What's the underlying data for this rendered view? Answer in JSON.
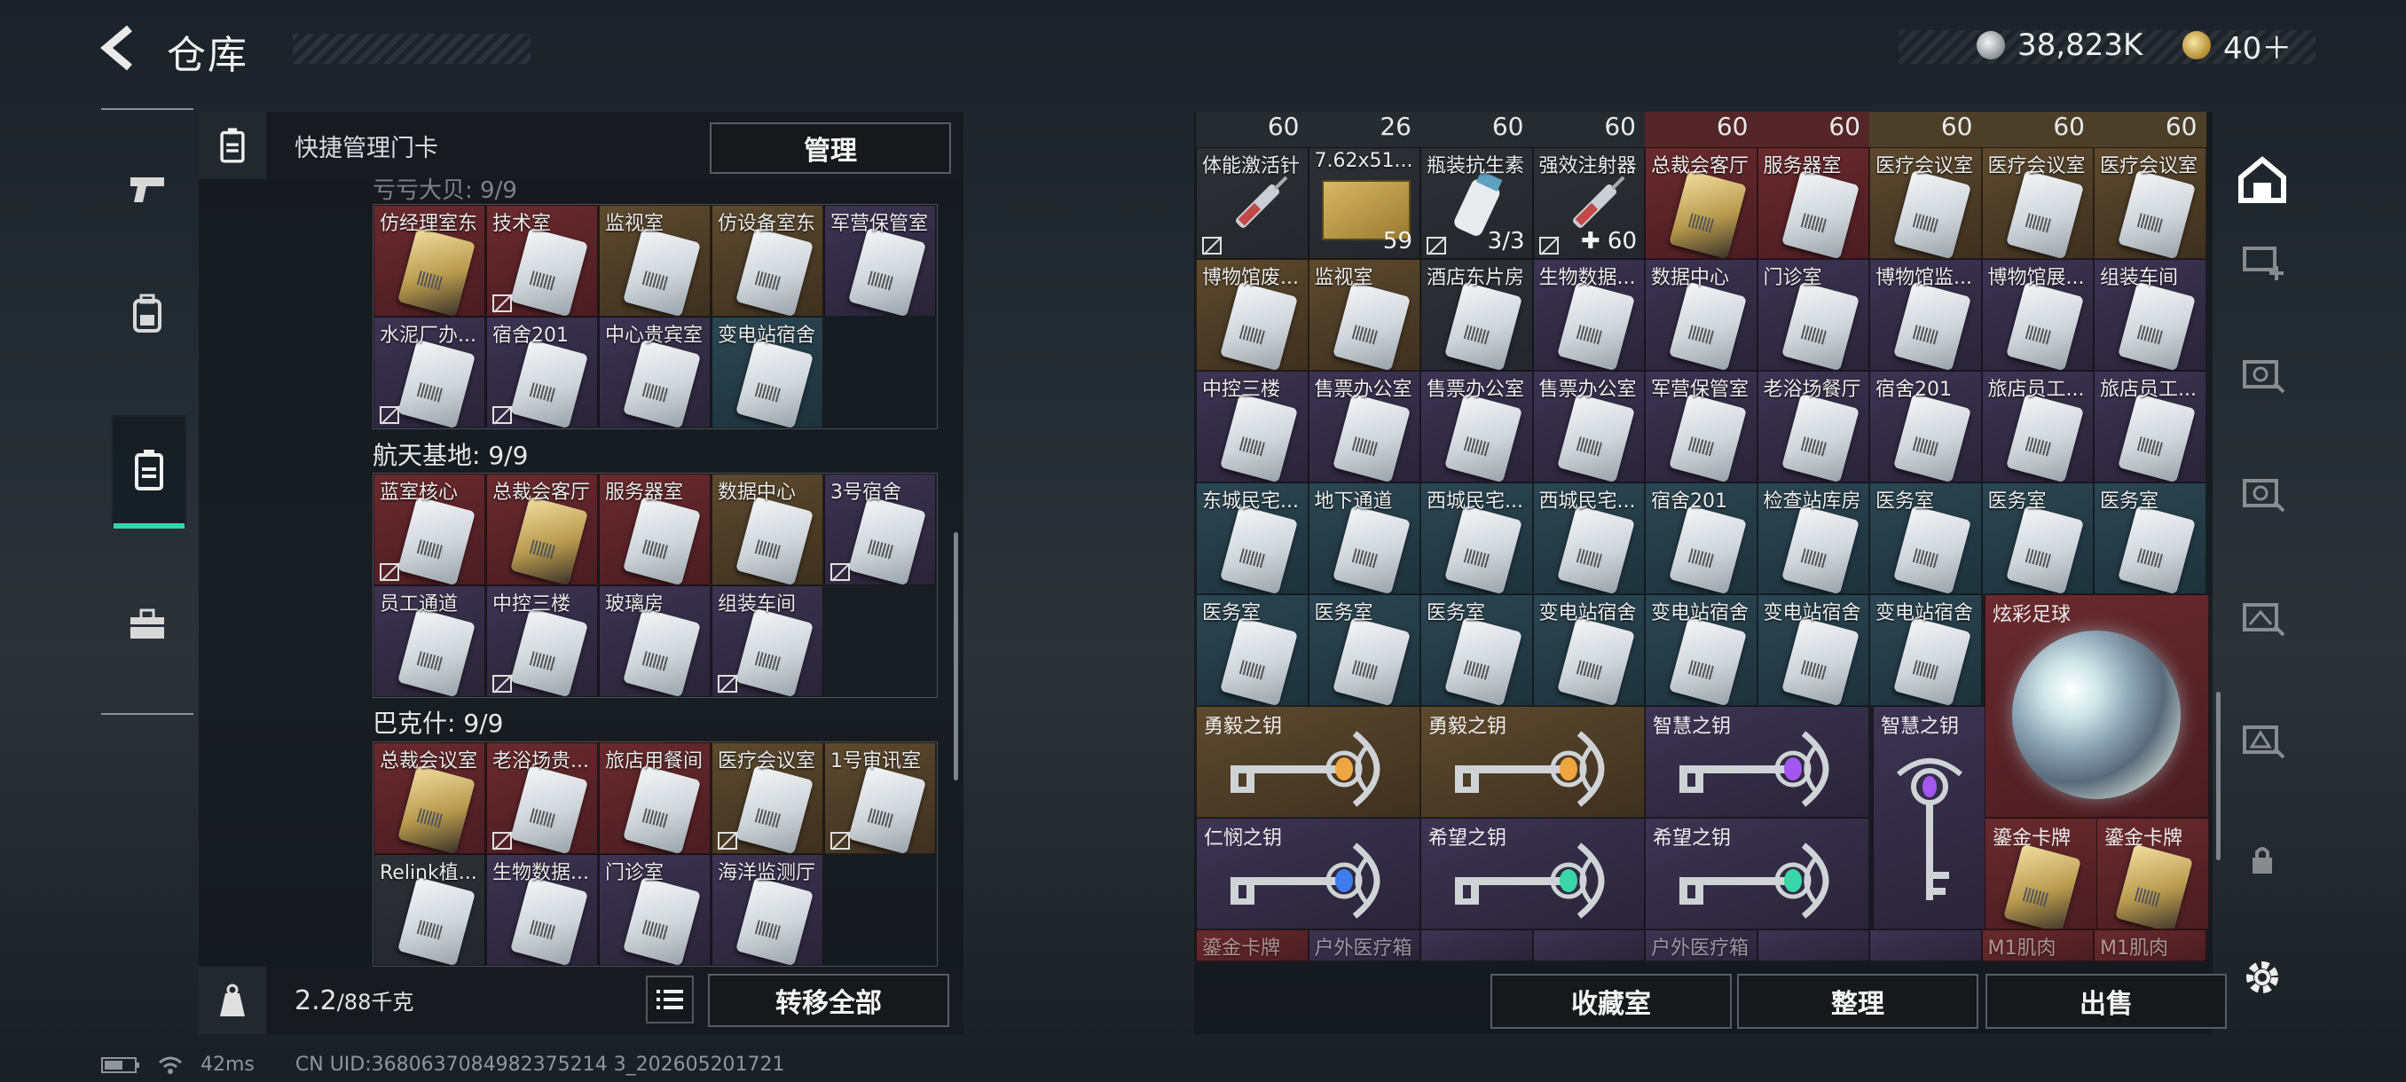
{
  "header": {
    "title": "仓库",
    "currency_silver": "38,823K",
    "currency_gold": "40＋"
  },
  "left_panel": {
    "header_label": "快捷管理门卡",
    "manage_button": "管理",
    "partial_section": "亏亏大贝: 9/9",
    "section1_cards": [
      {
        "name": "仿经理室东",
        "rarity": "r-red",
        "card": "gold",
        "nobind": false
      },
      {
        "name": "技术室",
        "rarity": "r-red",
        "card": "white",
        "nobind": true
      },
      {
        "name": "监视室",
        "rarity": "r-gold",
        "card": "white",
        "nobind": false
      },
      {
        "name": "仿设备室东",
        "rarity": "r-gold",
        "card": "white",
        "nobind": false
      },
      {
        "name": "军营保管室",
        "rarity": "r-purple",
        "card": "white",
        "nobind": false
      },
      {
        "name": "水泥厂办...",
        "rarity": "r-purple",
        "card": "white",
        "nobind": true
      },
      {
        "name": "宿舍201",
        "rarity": "r-purple",
        "card": "white",
        "nobind": true
      },
      {
        "name": "中心贵宾室",
        "rarity": "r-purple",
        "card": "white",
        "nobind": false
      },
      {
        "name": "变电站宿舍",
        "rarity": "r-blue",
        "card": "white",
        "nobind": false
      }
    ],
    "section2_title": "航天基地: 9/9",
    "section2_cards": [
      {
        "name": "蓝室核心",
        "rarity": "r-red",
        "card": "white",
        "nobind": true
      },
      {
        "name": "总裁会客厅",
        "rarity": "r-red",
        "card": "gold",
        "nobind": false
      },
      {
        "name": "服务器室",
        "rarity": "r-red",
        "card": "white",
        "nobind": false
      },
      {
        "name": "数据中心",
        "rarity": "r-gold",
        "card": "white",
        "nobind": false
      },
      {
        "name": "3号宿舍",
        "rarity": "r-purple",
        "card": "white",
        "nobind": true
      },
      {
        "name": "员工通道",
        "rarity": "r-purple",
        "card": "white",
        "nobind": false
      },
      {
        "name": "中控三楼",
        "rarity": "r-purple",
        "card": "white",
        "nobind": true
      },
      {
        "name": "玻璃房",
        "rarity": "r-purple",
        "card": "white",
        "nobind": false
      },
      {
        "name": "组装车间",
        "rarity": "r-purple",
        "card": "white",
        "nobind": true
      }
    ],
    "section3_title": "巴克什: 9/9",
    "section3_cards": [
      {
        "name": "总裁会议室",
        "rarity": "r-red",
        "card": "gold",
        "nobind": false
      },
      {
        "name": "老浴场贵...",
        "rarity": "r-red",
        "card": "white",
        "nobind": true
      },
      {
        "name": "旅店用餐间",
        "rarity": "r-red",
        "card": "white",
        "nobind": false
      },
      {
        "name": "医疗会议室",
        "rarity": "r-gold",
        "card": "white",
        "nobind": true
      },
      {
        "name": "1号审讯室",
        "rarity": "r-gold",
        "card": "white",
        "nobind": true
      },
      {
        "name": "Relink植...",
        "rarity": "r-dark",
        "card": "white",
        "nobind": false
      },
      {
        "name": "生物数据...",
        "rarity": "r-purple",
        "card": "white",
        "nobind": false
      },
      {
        "name": "门诊室",
        "rarity": "r-purple",
        "card": "white",
        "nobind": false
      },
      {
        "name": "海洋监测厅",
        "rarity": "r-purple",
        "card": "white",
        "nobind": false
      }
    ],
    "weight_value": "2.2",
    "weight_max": "/88千克",
    "transfer_button": "转移全部"
  },
  "right_panel": {
    "top_counts": [
      "60",
      "26",
      "60",
      "60",
      "60",
      "60",
      "60",
      "60",
      "60"
    ],
    "rows": [
      [
        {
          "name": "体能激活针",
          "rarity": "r-dark",
          "type": "syringe",
          "count": "",
          "nobind": true
        },
        {
          "name": "7.62x51...",
          "rarity": "r-dark",
          "type": "ammo",
          "count": "59",
          "nobind": false
        },
        {
          "name": "瓶装抗生素",
          "rarity": "r-dark",
          "type": "bottle",
          "count": "3/3",
          "nobind": true
        },
        {
          "name": "强效注射器",
          "rarity": "r-dark",
          "type": "syringe",
          "count": "✚ 60",
          "nobind": true
        },
        {
          "name": "总裁会客厅",
          "rarity": "r-red",
          "type": "card-gold",
          "count": "",
          "nobind": false
        },
        {
          "name": "服务器室",
          "rarity": "r-red",
          "type": "card",
          "count": "",
          "nobind": false
        },
        {
          "name": "医疗会议室",
          "rarity": "r-gold",
          "type": "card",
          "count": "",
          "nobind": false
        },
        {
          "name": "医疗会议室",
          "rarity": "r-gold",
          "type": "card",
          "count": "",
          "nobind": false
        },
        {
          "name": "医疗会议室",
          "rarity": "r-gold",
          "type": "card",
          "count": "",
          "nobind": false
        }
      ],
      [
        {
          "name": "博物馆废...",
          "rarity": "r-gold",
          "type": "card",
          "count": "",
          "nobind": false
        },
        {
          "name": "监视室",
          "rarity": "r-gold",
          "type": "card",
          "count": "",
          "nobind": false
        },
        {
          "name": "酒店东片房",
          "rarity": "r-dark",
          "type": "card",
          "count": "",
          "nobind": false
        },
        {
          "name": "生物数据...",
          "rarity": "r-purple",
          "type": "card",
          "count": "",
          "nobind": false
        },
        {
          "name": "数据中心",
          "rarity": "r-purple",
          "type": "card",
          "count": "",
          "nobind": false
        },
        {
          "name": "门诊室",
          "rarity": "r-purple",
          "type": "card",
          "count": "",
          "nobind": false
        },
        {
          "name": "博物馆监...",
          "rarity": "r-purple",
          "type": "card",
          "count": "",
          "nobind": false
        },
        {
          "name": "博物馆展...",
          "rarity": "r-purple",
          "type": "card",
          "count": "",
          "nobind": false
        },
        {
          "name": "组装车间",
          "rarity": "r-purple",
          "type": "card",
          "count": "",
          "nobind": false
        }
      ],
      [
        {
          "name": "中控三楼",
          "rarity": "r-purple",
          "type": "card",
          "count": "",
          "nobind": false
        },
        {
          "name": "售票办公室",
          "rarity": "r-purple",
          "type": "card",
          "count": "",
          "nobind": false
        },
        {
          "name": "售票办公室",
          "rarity": "r-purple",
          "type": "card",
          "count": "",
          "nobind": false
        },
        {
          "name": "售票办公室",
          "rarity": "r-purple",
          "type": "card",
          "count": "",
          "nobind": false
        },
        {
          "name": "军营保管室",
          "rarity": "r-purple",
          "type": "card",
          "count": "",
          "nobind": false
        },
        {
          "name": "老浴场餐厅",
          "rarity": "r-purple",
          "type": "card",
          "count": "",
          "nobind": false
        },
        {
          "name": "宿舍201",
          "rarity": "r-purple",
          "type": "card",
          "count": "",
          "nobind": false
        },
        {
          "name": "旅店员工...",
          "rarity": "r-purple",
          "type": "card",
          "count": "",
          "nobind": false
        },
        {
          "name": "旅店员工...",
          "rarity": "r-purple",
          "type": "card",
          "count": "",
          "nobind": false
        }
      ],
      [
        {
          "name": "东城民宅...",
          "rarity": "r-blue",
          "type": "card",
          "count": "",
          "nobind": false
        },
        {
          "name": "地下通道",
          "rarity": "r-blue",
          "type": "card",
          "count": "",
          "nobind": false
        },
        {
          "name": "西城民宅...",
          "rarity": "r-blue",
          "type": "card",
          "count": "",
          "nobind": false
        },
        {
          "name": "西城民宅...",
          "rarity": "r-blue",
          "type": "card",
          "count": "",
          "nobind": false
        },
        {
          "name": "宿舍201",
          "rarity": "r-blue",
          "type": "card",
          "count": "",
          "nobind": false
        },
        {
          "name": "检查站库房",
          "rarity": "r-blue",
          "type": "card",
          "count": "",
          "nobind": false
        },
        {
          "name": "医务室",
          "rarity": "r-blue",
          "type": "card",
          "count": "",
          "nobind": false
        },
        {
          "name": "医务室",
          "rarity": "r-blue",
          "type": "card",
          "count": "",
          "nobind": false
        },
        {
          "name": "医务室",
          "rarity": "r-blue",
          "type": "card",
          "count": "",
          "nobind": false
        }
      ],
      [
        {
          "name": "医务室",
          "rarity": "r-blue",
          "type": "card",
          "count": "",
          "nobind": false
        },
        {
          "name": "医务室",
          "rarity": "r-blue",
          "type": "card",
          "count": "",
          "nobind": false
        },
        {
          "name": "医务室",
          "rarity": "r-blue",
          "type": "card",
          "count": "",
          "nobind": false
        },
        {
          "name": "变电站宿舍",
          "rarity": "r-blue",
          "type": "card",
          "count": "",
          "nobind": false
        },
        {
          "name": "变电站宿舍",
          "rarity": "r-blue",
          "type": "card",
          "count": "",
          "nobind": false
        },
        {
          "name": "变电站宿舍",
          "rarity": "r-blue",
          "type": "card",
          "count": "",
          "nobind": false
        },
        {
          "name": "变电站宿舍",
          "rarity": "r-blue",
          "type": "card",
          "count": "",
          "nobind": false
        }
      ]
    ],
    "ball_name": "炫彩足球",
    "keys": [
      {
        "name": "勇毅之钥",
        "rarity": "r-gold",
        "gem": "#f0a640"
      },
      {
        "name": "勇毅之钥",
        "rarity": "r-gold",
        "gem": "#f0a640"
      },
      {
        "name": "智慧之钥",
        "rarity": "r-purple",
        "gem": "#a356f0"
      },
      {
        "name": "仁悯之钥",
        "rarity": "r-purple",
        "gem": "#3d7df0"
      },
      {
        "name": "希望之钥",
        "rarity": "r-purple",
        "gem": "#39d6a8"
      },
      {
        "name": "希望之钥",
        "rarity": "r-purple",
        "gem": "#39d6a8"
      }
    ],
    "tall_key_name": "智慧之钥",
    "gold_cards": [
      "鎏金卡牌",
      "鎏金卡牌"
    ],
    "partial_row": [
      "鎏金卡牌",
      "户外医疗箱",
      "",
      "",
      "户外医疗箱",
      "",
      "",
      "M1肌肉",
      "M1肌肉"
    ],
    "buttons": {
      "collection": "收藏室",
      "sort": "整理",
      "sell": "出售"
    }
  },
  "status": {
    "ping": "42ms",
    "uid": "CN UID:3680637084982375214 3_202605201721"
  }
}
